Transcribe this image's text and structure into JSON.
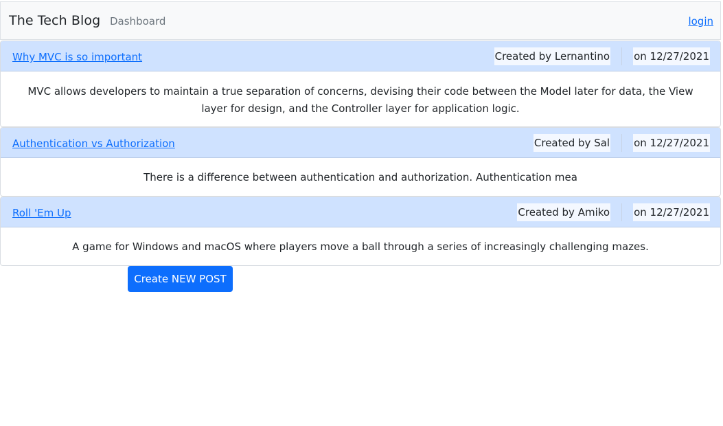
{
  "navbar": {
    "brand": "The Tech Blog",
    "dashboard_link": "Dashboard",
    "login_link": "login"
  },
  "posts": [
    {
      "title": "Why MVC is so important",
      "author": "Created by Lernantino",
      "date": "on 12/27/2021",
      "body": "MVC allows developers to maintain a true separation of concerns, devising their code between the Model later for data, the View layer for design, and the Controller layer for application logic."
    },
    {
      "title": "Authentication vs Authorization",
      "author": "Created by Sal",
      "date": "on 12/27/2021",
      "body": "There is a difference between authentication and authorization. Authentication mea"
    },
    {
      "title": "Roll 'Em Up",
      "author": "Created by Amiko",
      "date": "on 12/27/2021",
      "body": "A game for Windows and macOS where players move a ball through a series of increasingly challenging mazes."
    }
  ],
  "actions": {
    "create_post_label": "Create NEW POST"
  },
  "colors": {
    "primary": "#0d6efd",
    "card_header": "#cfe2ff",
    "navbar_bg": "#f8f9fa"
  }
}
